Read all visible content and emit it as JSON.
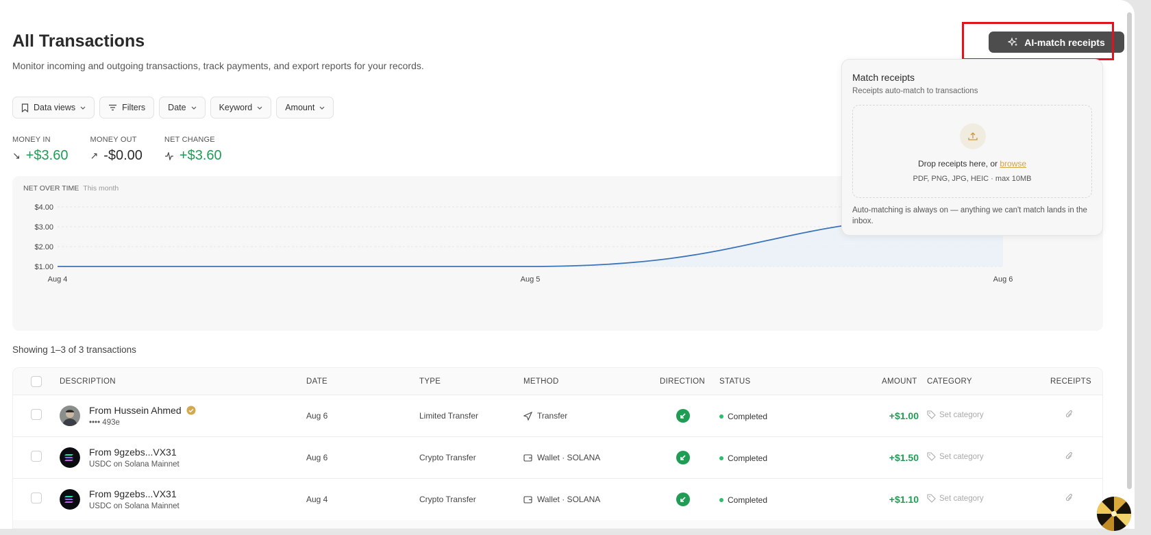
{
  "header": {
    "title": "All Transactions",
    "subtitle": "Monitor incoming and outgoing transactions, track payments, and export reports for your records.",
    "ai_button": "AI-match receipts"
  },
  "filters": [
    "Data views",
    "Filters",
    "Date",
    "Keyword",
    "Amount"
  ],
  "kpis": [
    {
      "label": "MONEY IN",
      "value": "+$3.60",
      "icon": "arrow-down-right-icon"
    },
    {
      "label": "MONEY OUT",
      "value": "-$0.00",
      "icon": "arrow-up-right-icon"
    },
    {
      "label": "NET CHANGE",
      "value": "+$3.60",
      "icon": "activity-icon"
    }
  ],
  "chart_data": {
    "type": "line",
    "title": "NET OVER TIME",
    "subtitle": "This month",
    "x": [
      "Aug 4",
      "Aug 5",
      "Aug 6"
    ],
    "series": [
      {
        "values": [
          1.0,
          1.0,
          3.6
        ]
      }
    ],
    "y_ticks": [
      "$1.00",
      "$2.00",
      "$3.00",
      "$4.00"
    ],
    "ylim": [
      1.0,
      4.0
    ],
    "grid": true,
    "colors": {
      "line": "#3a73b8",
      "fill": "#e9f0f8"
    }
  },
  "showing": "Showing 1–3 of 3 transactions",
  "table": {
    "columns": [
      "DESCRIPTION",
      "DATE",
      "TYPE",
      "METHOD",
      "DIRECTION",
      "STATUS",
      "AMOUNT",
      "CATEGORY",
      "RECEIPTS"
    ],
    "rows": [
      {
        "title": "From Hussein Ahmed",
        "sub": "•••• 493e",
        "date": "Aug 6",
        "type": "Limited Transfer",
        "method": "Transfer",
        "status": "Completed",
        "amount": "+$1.00",
        "category": "Set category",
        "verified": true
      },
      {
        "title": "From 9gzebs...VX31",
        "sub": "USDC on Solana Mainnet",
        "date": "Aug 6",
        "type": "Crypto Transfer",
        "method": "Wallet · SOLANA",
        "status": "Completed",
        "amount": "+$1.50",
        "category": "Set category",
        "verified": false
      },
      {
        "title": "From 9gzebs...VX31",
        "sub": "USDC on Solana Mainnet",
        "date": "Aug 4",
        "type": "Crypto Transfer",
        "method": "Wallet · SOLANA",
        "status": "Completed",
        "amount": "+$1.10",
        "category": "Set category",
        "verified": false
      }
    ]
  },
  "popover": {
    "title": "Match receipts",
    "subtitle": "Receipts auto-match to transactions",
    "drop_prefix": "Drop receipts here, or ",
    "drop_link": "browse",
    "formats": "PDF, PNG, JPG, HEIC · max 10MB",
    "footer": "Auto-matching is always on — anything we can't match lands in the inbox."
  },
  "colors": {
    "accent_green": "#1f9d55",
    "highlight": "#e0141e",
    "link": "#d2a245"
  }
}
